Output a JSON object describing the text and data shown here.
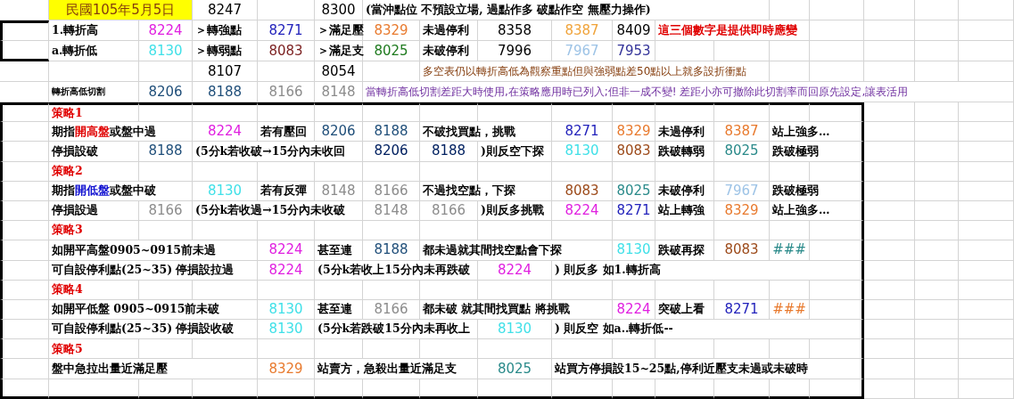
{
  "sheet": {
    "rows": [
      {
        "cells": [
          "",
          {
            "kind": "date",
            "text": "民國105年5月5日"
          },
          "",
          {
            "kind": "number",
            "text": "8247"
          },
          "",
          {
            "kind": "number",
            "text": "8300"
          },
          {
            "kind": "label",
            "text": "(當沖點位 不預設立場, 過點作多 破點作空 無壓力操作)"
          }
        ]
      },
      {
        "cells": [
          "",
          {
            "kind": "label",
            "text": "1.轉折高"
          },
          {
            "kind": "number",
            "text": "8224",
            "color": "#e020e0"
          },
          {
            "kind": "label",
            "text": "＞轉強點"
          },
          {
            "kind": "number",
            "text": "8271",
            "color": "#2222bb"
          },
          {
            "kind": "label",
            "text": "＞滿足壓"
          },
          {
            "kind": "number",
            "text": "8329",
            "color": "#e87a2e"
          },
          {
            "kind": "label",
            "text": "未過停利"
          },
          {
            "kind": "number",
            "text": "8358"
          },
          {
            "kind": "number",
            "text": "8387",
            "color": "#f0a33a"
          },
          {
            "kind": "number",
            "text": "8409"
          },
          {
            "kind": "label",
            "text": "這三個數字是提供即時應變",
            "color": "#e00000"
          }
        ]
      },
      {
        "cells": [
          "",
          {
            "kind": "label",
            "text": "a.轉折低"
          },
          {
            "kind": "number",
            "text": "8130",
            "color": "#40e0e8"
          },
          {
            "kind": "label",
            "text": "＞轉弱點"
          },
          {
            "kind": "number",
            "text": "8083",
            "color": "#7a1e1e"
          },
          {
            "kind": "label",
            "text": "＞滿足支"
          },
          {
            "kind": "number",
            "text": "8025",
            "color": "#1e7a1e"
          },
          {
            "kind": "label",
            "text": "未破停利"
          },
          {
            "kind": "number",
            "text": "7996"
          },
          {
            "kind": "number",
            "text": "7967",
            "color": "#9dc3e6"
          },
          {
            "kind": "number",
            "text": "7953",
            "color": "#333399"
          }
        ]
      },
      {
        "cells": [
          "",
          "",
          "",
          {
            "kind": "number",
            "text": "8107"
          },
          "",
          {
            "kind": "number",
            "text": "8054"
          },
          "",
          {
            "kind": "note",
            "text": "多空表仍以轉折高低為觀察重點但與強弱點差50點以上就多設折衝點",
            "color": "#843c0c"
          }
        ]
      },
      {
        "cells": [
          "",
          {
            "kind": "small",
            "text": "轉折高低切割"
          },
          {
            "kind": "number",
            "text": "8206",
            "color": "#1f4e79"
          },
          {
            "kind": "number",
            "text": "8188",
            "color": "#1f4e79"
          },
          {
            "kind": "number",
            "text": "8166",
            "color": "#8c8c8c"
          },
          {
            "kind": "number",
            "text": "8148",
            "color": "#8c8c8c"
          },
          {
            "kind": "note",
            "text": "當轉折高低切割差距大時使用,在策略應用時已列入;但非一成不變! 差距小亦可撤除此切割率而回原先設定,讓表活用",
            "color": "#7030a0"
          }
        ]
      },
      {
        "cells": [
          "",
          {
            "kind": "heading",
            "text": "策略1"
          }
        ]
      },
      {
        "cells": [
          "",
          {
            "kind": "label",
            "parts": [
              {
                "text": "期指"
              },
              {
                "text": "開高盤",
                "color": "#e00000"
              },
              {
                "text": "或盤中過"
              }
            ]
          },
          "",
          {
            "kind": "number",
            "text": "8224",
            "color": "#e020e0"
          },
          {
            "kind": "label",
            "text": "若有壓回"
          },
          {
            "kind": "number",
            "text": "8206",
            "color": "#1f4e79"
          },
          {
            "kind": "number",
            "text": "8188",
            "color": "#1f4e79"
          },
          {
            "kind": "label",
            "text": "不破找買點，挑戰"
          },
          "",
          {
            "kind": "number",
            "text": "8271",
            "color": "#2222bb"
          },
          {
            "kind": "number",
            "text": "8329",
            "color": "#e87a2e"
          },
          {
            "kind": "label",
            "text": "未過停利"
          },
          {
            "kind": "number",
            "text": "8387",
            "color": "#e87a2e"
          },
          {
            "kind": "label",
            "text": "站上強多…"
          }
        ]
      },
      {
        "cells": [
          "",
          {
            "kind": "label",
            "text": "停損設破"
          },
          {
            "kind": "number",
            "text": "8188",
            "color": "#1f4e79"
          },
          {
            "kind": "label",
            "text": "(5分k若收破→15分內未收回"
          },
          "",
          "",
          {
            "kind": "number",
            "text": "8206",
            "color": "#002060"
          },
          {
            "kind": "number",
            "text": "8188",
            "color": "#002060"
          },
          {
            "kind": "label",
            "text": ")則反空下探"
          },
          {
            "kind": "number",
            "text": "8130",
            "color": "#40e0e8"
          },
          {
            "kind": "number",
            "text": "8083",
            "color": "#9c4a1a"
          },
          {
            "kind": "label",
            "text": "跌破轉弱"
          },
          {
            "kind": "number",
            "text": "8025",
            "color": "#2a8a8a"
          },
          {
            "kind": "label",
            "text": "跌破極弱"
          }
        ]
      },
      {
        "cells": [
          "",
          {
            "kind": "heading",
            "text": "策略2"
          }
        ]
      },
      {
        "cells": [
          "",
          {
            "kind": "label",
            "parts": [
              {
                "text": "期指"
              },
              {
                "text": "開低盤",
                "color": "#1010d0"
              },
              {
                "text": "或盤中破"
              }
            ]
          },
          "",
          {
            "kind": "number",
            "text": "8130",
            "color": "#40e0e8"
          },
          {
            "kind": "label",
            "text": "若有反彈"
          },
          {
            "kind": "number",
            "text": "8148",
            "color": "#8c8c8c"
          },
          {
            "kind": "number",
            "text": "8166",
            "color": "#8c8c8c"
          },
          {
            "kind": "label",
            "text": "不過找空點，下探"
          },
          "",
          {
            "kind": "number",
            "text": "8083",
            "color": "#9c4a1a"
          },
          {
            "kind": "number",
            "text": "8025",
            "color": "#2a8a8a"
          },
          {
            "kind": "label",
            "text": "未破停利"
          },
          {
            "kind": "number",
            "text": "7967",
            "color": "#9dc3e6"
          },
          {
            "kind": "label",
            "text": "跌破極弱"
          }
        ]
      },
      {
        "cells": [
          "",
          {
            "kind": "label",
            "text": "停損設過"
          },
          {
            "kind": "number",
            "text": "8166",
            "color": "#8c8c8c"
          },
          {
            "kind": "label",
            "text": "(5分k若收過→15分內未收破"
          },
          "",
          "",
          {
            "kind": "number",
            "text": "8148",
            "color": "#8c8c8c"
          },
          {
            "kind": "number",
            "text": "8166",
            "color": "#8c8c8c"
          },
          {
            "kind": "label",
            "text": ")則反多挑戰"
          },
          {
            "kind": "number",
            "text": "8224",
            "color": "#e020e0"
          },
          {
            "kind": "number",
            "text": "8271",
            "color": "#2222bb"
          },
          {
            "kind": "label",
            "text": "站上轉強"
          },
          {
            "kind": "number",
            "text": "8329",
            "color": "#e87a2e"
          },
          {
            "kind": "label",
            "text": "站上強多…"
          }
        ]
      },
      {
        "cells": [
          "",
          {
            "kind": "heading",
            "text": "策略3"
          }
        ]
      },
      {
        "cells": [
          "",
          {
            "kind": "label",
            "text": "如開平高盤0905~0915前未過"
          },
          "",
          "",
          {
            "kind": "number",
            "text": "8224",
            "color": "#e020e0"
          },
          {
            "kind": "label",
            "text": "甚至連"
          },
          {
            "kind": "number",
            "text": "8188",
            "color": "#1f4e79"
          },
          {
            "kind": "label",
            "text": "都未過就其間找空點會下探"
          },
          "",
          "",
          {
            "kind": "number",
            "text": "8130",
            "color": "#40e0e8"
          },
          {
            "kind": "label",
            "text": "跌破再探"
          },
          {
            "kind": "number",
            "text": "8083",
            "color": "#9c4a1a"
          },
          {
            "kind": "number",
            "text": "###",
            "color": "#2a8a8a"
          }
        ]
      },
      {
        "cells": [
          "",
          {
            "kind": "label",
            "text": "可自設停利點(25~35) 停損設拉過"
          },
          "",
          "",
          {
            "kind": "number",
            "text": "8224",
            "color": "#e020e0"
          },
          {
            "kind": "label",
            "text": "(5分k若收上15分內未再跌破"
          },
          "",
          "",
          {
            "kind": "number",
            "text": "8224",
            "color": "#e020e0"
          },
          {
            "kind": "label",
            "text": ") 則反多 如1.轉折高"
          }
        ]
      },
      {
        "cells": [
          "",
          {
            "kind": "heading",
            "text": "策略4"
          }
        ]
      },
      {
        "cells": [
          "",
          {
            "kind": "label",
            "text": "如開平低盤 0905~0915前未破"
          },
          "",
          "",
          {
            "kind": "number",
            "text": "8130",
            "color": "#40e0e8"
          },
          {
            "kind": "label",
            "text": "甚至連"
          },
          {
            "kind": "number",
            "text": "8166",
            "color": "#8c8c8c"
          },
          {
            "kind": "label",
            "text": "都未破 就其間找買點 將挑戰"
          },
          "",
          "",
          {
            "kind": "number",
            "text": "8224",
            "color": "#e020e0"
          },
          {
            "kind": "label",
            "text": "突破上看"
          },
          {
            "kind": "number",
            "text": "8271",
            "color": "#2222bb"
          },
          {
            "kind": "number",
            "text": "###",
            "color": "#e87a2e"
          }
        ]
      },
      {
        "cells": [
          "",
          {
            "kind": "label",
            "text": "可自設停利點(25~35) 停損設收破"
          },
          "",
          "",
          {
            "kind": "number",
            "text": "8130",
            "color": "#40e0e8"
          },
          {
            "kind": "label",
            "text": "(5分k若跌破15分內未再收上"
          },
          "",
          "",
          {
            "kind": "number",
            "text": "8130",
            "color": "#40e0e8"
          },
          {
            "kind": "label",
            "text": ") 則反空 如a..轉折低--"
          }
        ]
      },
      {
        "cells": [
          "",
          {
            "kind": "heading",
            "text": "策略5"
          }
        ]
      },
      {
        "cells": [
          "",
          {
            "kind": "label",
            "text": "盤中急拉出量近滿足壓"
          },
          "",
          "",
          {
            "kind": "number",
            "text": "8329",
            "color": "#e87a2e"
          },
          {
            "kind": "label",
            "text": "站賣方，急殺出量近滿足支"
          },
          "",
          "",
          {
            "kind": "number",
            "text": "8025",
            "color": "#2a8a8a"
          },
          {
            "kind": "label",
            "text": "站買方停損設15~25點,停利近壓支未過或未破時"
          }
        ]
      }
    ]
  }
}
